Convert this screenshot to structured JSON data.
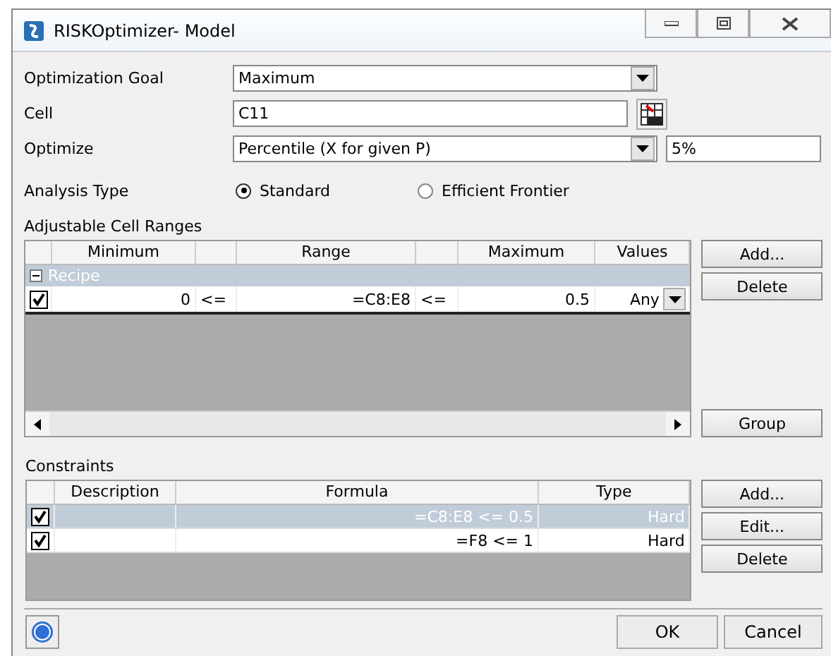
{
  "window": {
    "title": "RISKOptimizer- Model"
  },
  "goal": {
    "label": "Optimization Goal",
    "value": "Maximum"
  },
  "cell": {
    "label": "Cell",
    "value": "C11"
  },
  "optimize": {
    "label": "Optimize",
    "value": "Percentile (X for given P)",
    "percent": "5%"
  },
  "analysis": {
    "label": "Analysis Type",
    "options": [
      {
        "label": "Standard",
        "selected": true
      },
      {
        "label": "Efficient Frontier",
        "selected": false
      }
    ]
  },
  "ranges": {
    "label": "Adjustable Cell Ranges",
    "columns": {
      "minimum": "Minimum",
      "range": "Range",
      "maximum": "Maximum",
      "values": "Values"
    },
    "groups": [
      {
        "label": "Recipe",
        "expanded": true,
        "rows": [
          {
            "checked": true,
            "minimum": "0",
            "op1": "<=",
            "range": "=C8:E8",
            "op2": "<=",
            "maximum": "0.5",
            "values": "Any"
          }
        ]
      }
    ],
    "buttons": [
      "Add...",
      "Delete"
    ],
    "group_button": "Group"
  },
  "constraints": {
    "label": "Constraints",
    "columns": {
      "description": "Description",
      "formula": "Formula",
      "type": "Type"
    },
    "rows": [
      {
        "checked": true,
        "selected": true,
        "formula": "=C8:E8 <= 0.5",
        "type": "Hard"
      },
      {
        "checked": true,
        "selected": false,
        "formula": "=F8 <= 1",
        "type": "Hard"
      }
    ],
    "buttons": [
      "Add...",
      "Edit...",
      "Delete"
    ]
  },
  "footer": {
    "buttons": [
      "OK",
      "Cancel"
    ]
  }
}
